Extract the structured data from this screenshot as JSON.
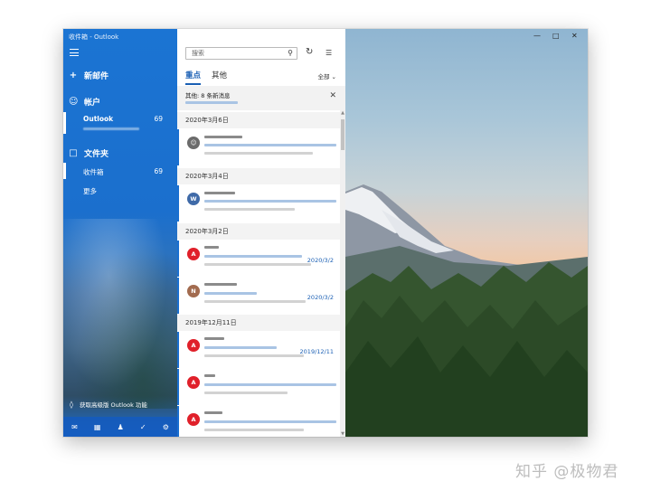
{
  "window": {
    "title": "收件箱 - Outlook"
  },
  "sidebar": {
    "new_mail": "新邮件",
    "accounts_header": "帐户",
    "account_name": "Outlook",
    "account_count": "69",
    "folders_header": "文件夹",
    "inbox_label": "收件箱",
    "inbox_count": "69",
    "more_label": "更多",
    "promo": "获取高级版 Outlook 功能",
    "icons": [
      "mail-icon",
      "calendar-icon",
      "people-icon",
      "todo-icon",
      "settings-icon"
    ]
  },
  "list": {
    "search_placeholder": "搜索",
    "tabs": [
      {
        "label": "重点",
        "active": true
      },
      {
        "label": "其他",
        "active": false
      }
    ],
    "filter_label": "全部",
    "others_banner": "其他: 8 条新消息",
    "groups": [
      {
        "date": "2020年3月6日"
      },
      {
        "date": "2020年3月4日"
      },
      {
        "date": "2020年3月2日"
      },
      {
        "date": "2019年12月11日"
      }
    ],
    "messages": [
      {
        "avatar": "",
        "date": ""
      },
      {
        "avatar": "W",
        "date": ""
      },
      {
        "avatar": "A",
        "date": "2020/3/2"
      },
      {
        "avatar": "N",
        "date": "2020/3/2"
      },
      {
        "avatar": "A",
        "date": "2019/12/11"
      },
      {
        "avatar": "A",
        "date": ""
      },
      {
        "avatar": "A",
        "date": ""
      }
    ]
  },
  "colors": {
    "accent": "#1a5fb4",
    "avatar_red": "#e0202a",
    "avatar_blue": "#3f6aa8",
    "avatar_brown": "#a26b4f",
    "avatar_gray": "#6b6b6b"
  },
  "watermark": "知乎 @极物君"
}
